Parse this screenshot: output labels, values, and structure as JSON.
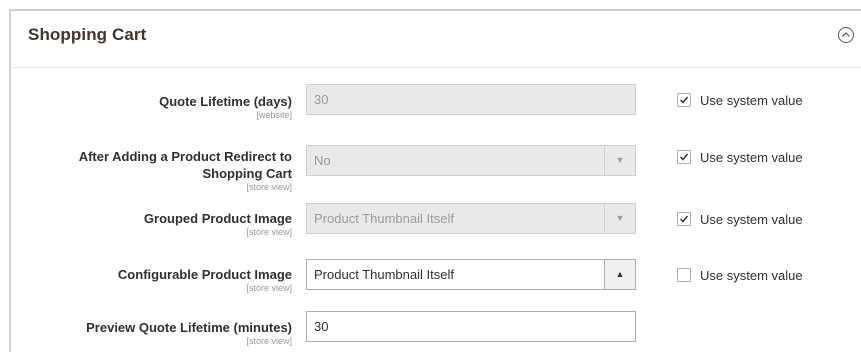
{
  "section": {
    "title": "Shopping Cart",
    "collapse_icon": "chevron-up-circle-icon"
  },
  "rows": [
    {
      "label": "Quote Lifetime (days)",
      "scope": "[website]",
      "type": "input",
      "value": "30",
      "disabled": true,
      "use_system_value": true,
      "use_system_label": "Use system value"
    },
    {
      "label_line1": "After Adding a Product Redirect to",
      "label_line2": "Shopping Cart",
      "scope": "[store view]",
      "type": "select",
      "value": "No",
      "disabled": true,
      "use_system_value": true,
      "use_system_label": "Use system value"
    },
    {
      "label": "Grouped Product Image",
      "scope": "[store view]",
      "type": "select",
      "value": "Product Thumbnail Itself",
      "disabled": true,
      "use_system_value": true,
      "use_system_label": "Use system value"
    },
    {
      "label": "Configurable Product Image",
      "scope": "[store view]",
      "type": "select",
      "value": "Product Thumbnail Itself",
      "disabled": false,
      "use_system_value": false,
      "use_system_label": "Use system value"
    },
    {
      "label": "Preview Quote Lifetime (minutes)",
      "scope": "[store view]",
      "type": "input",
      "value": "30",
      "disabled": false
    }
  ],
  "icons": {
    "select_closed": "chevron-down-icon",
    "select_open": "chevron-up-icon",
    "check": "checkmark-icon"
  }
}
